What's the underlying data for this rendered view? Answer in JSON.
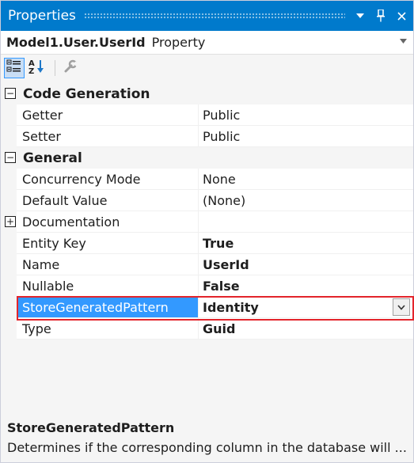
{
  "window": {
    "title": "Properties"
  },
  "object": {
    "name": "Model1.User.UserId",
    "type": "Property"
  },
  "grid": {
    "categories": [
      {
        "label": "Code Generation",
        "properties": [
          {
            "name": "Getter",
            "value": "Public"
          },
          {
            "name": "Setter",
            "value": "Public"
          }
        ]
      },
      {
        "label": "General",
        "properties": [
          {
            "name": "Concurrency Mode",
            "value": "None"
          },
          {
            "name": "Default Value",
            "value": "(None)"
          },
          {
            "name": "Documentation",
            "value": ""
          },
          {
            "name": "Entity Key",
            "value": "True"
          },
          {
            "name": "Name",
            "value": "UserId"
          },
          {
            "name": "Nullable",
            "value": "False"
          },
          {
            "name": "StoreGeneratedPattern",
            "value": "Identity"
          },
          {
            "name": "Type",
            "value": "Guid"
          }
        ]
      }
    ]
  },
  "description": {
    "title": "StoreGeneratedPattern",
    "text": "Determines if the corresponding column in the database will ..."
  },
  "colors": {
    "titlebar": "#007acc",
    "selection": "#3399ff",
    "highlight_outline": "#e3242b"
  }
}
